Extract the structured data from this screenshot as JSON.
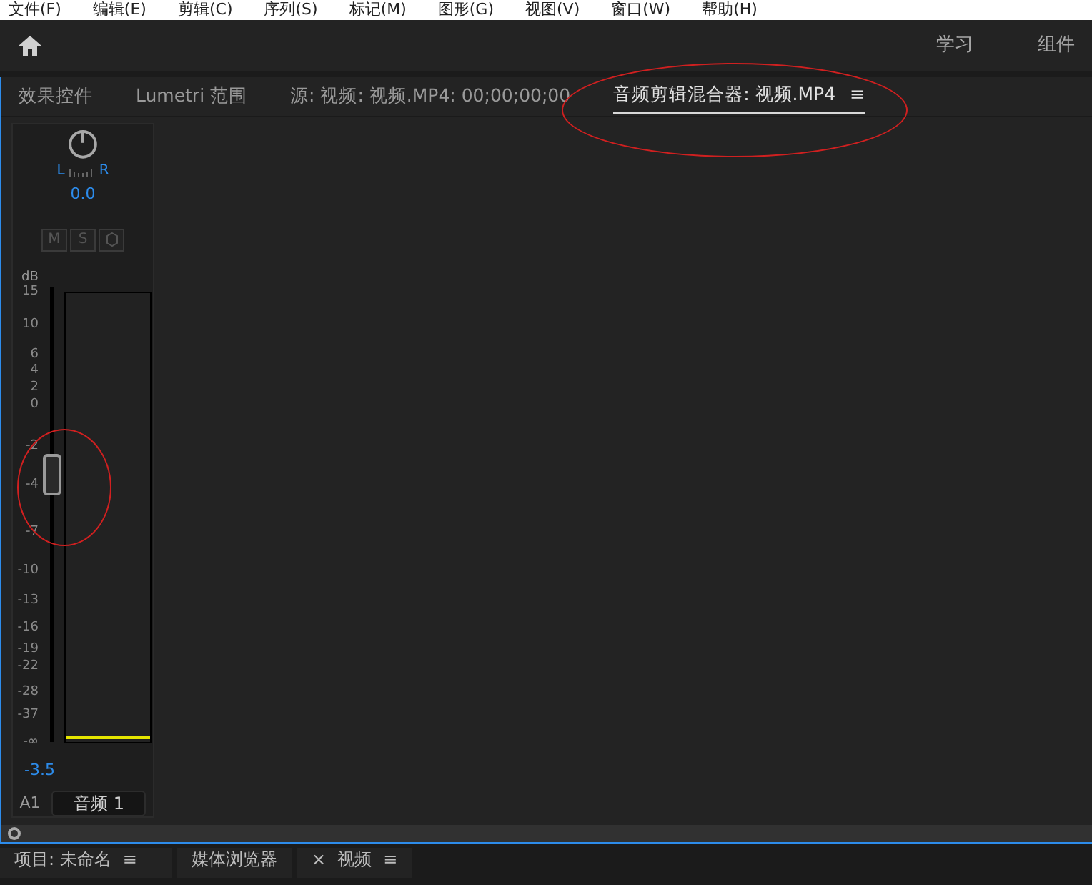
{
  "menu": [
    "文件(F)",
    "编辑(E)",
    "剪辑(C)",
    "序列(S)",
    "标记(M)",
    "图形(G)",
    "视图(V)",
    "窗口(W)",
    "帮助(H)"
  ],
  "workspaces": [
    "学习",
    "组件"
  ],
  "panel_tabs": [
    {
      "label": "效果控件",
      "selected": false
    },
    {
      "label": "Lumetri 范围",
      "selected": false
    },
    {
      "label": "源: 视频: 视频.MP4: 00;00;00;00",
      "selected": false
    },
    {
      "label": "音频剪辑混合器: 视频.MP4",
      "selected": true,
      "menu": "≡"
    }
  ],
  "channel": {
    "pan_left": "L",
    "pan_right": "R",
    "pan_value": "0.0",
    "buttons": [
      "M",
      "S"
    ],
    "scale_unit": "dB",
    "scale": [
      "15",
      "10",
      "6",
      "4",
      "2",
      "0",
      "-2",
      "-4",
      "-7",
      "-10",
      "-13",
      "-16",
      "-19",
      "-22",
      "-28",
      "-37",
      "-∞"
    ],
    "fader": {
      "level": 0.59
    },
    "volume": "-3.5",
    "track_id": "A1",
    "track_name": "音频 1"
  },
  "bottom_tabs": [
    {
      "label": "项目: 未命名",
      "menu": "≡"
    },
    {
      "label": "媒体浏览器"
    },
    {
      "label": "视频",
      "close": "×",
      "menu": "≡"
    }
  ]
}
